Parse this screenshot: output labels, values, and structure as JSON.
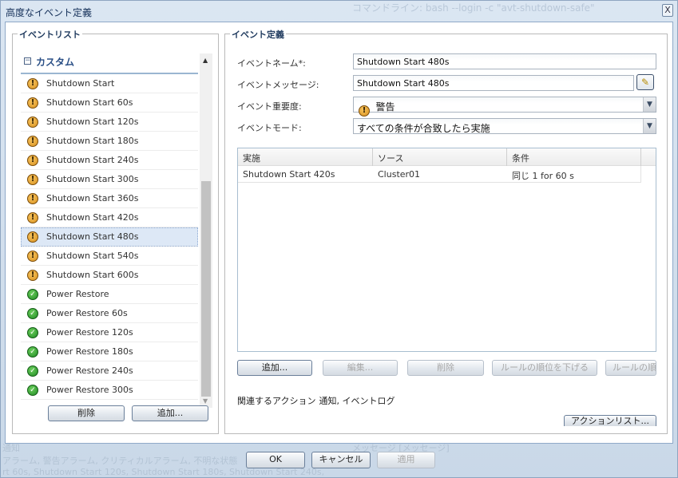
{
  "window": {
    "title": "高度なイベント定義",
    "background_title": "コマンドライン: bash --login -c \"avt-shutdown-safe\"",
    "close_label": "X"
  },
  "event_list": {
    "legend": "イベントリスト",
    "group": {
      "toggle": "⊟",
      "label": "カスタム"
    },
    "items": [
      {
        "label": "Shutdown Start",
        "severity": "warning",
        "selected": false
      },
      {
        "label": "Shutdown Start 60s",
        "severity": "warning",
        "selected": false
      },
      {
        "label": "Shutdown Start 120s",
        "severity": "warning",
        "selected": false
      },
      {
        "label": "Shutdown Start 180s",
        "severity": "warning",
        "selected": false
      },
      {
        "label": "Shutdown Start 240s",
        "severity": "warning",
        "selected": false
      },
      {
        "label": "Shutdown Start 300s",
        "severity": "warning",
        "selected": false
      },
      {
        "label": "Shutdown Start 360s",
        "severity": "warning",
        "selected": false
      },
      {
        "label": "Shutdown Start 420s",
        "severity": "warning",
        "selected": false
      },
      {
        "label": "Shutdown Start 480s",
        "severity": "warning",
        "selected": true
      },
      {
        "label": "Shutdown Start 540s",
        "severity": "warning",
        "selected": false
      },
      {
        "label": "Shutdown Start 600s",
        "severity": "warning",
        "selected": false
      },
      {
        "label": "Power Restore",
        "severity": "ok",
        "selected": false
      },
      {
        "label": "Power Restore 60s",
        "severity": "ok",
        "selected": false
      },
      {
        "label": "Power Restore 120s",
        "severity": "ok",
        "selected": false
      },
      {
        "label": "Power Restore 180s",
        "severity": "ok",
        "selected": false
      },
      {
        "label": "Power Restore 240s",
        "severity": "ok",
        "selected": false
      },
      {
        "label": "Power Restore 300s",
        "severity": "ok",
        "selected": false
      }
    ],
    "delete_label": "削除",
    "add_label": "追加..."
  },
  "event_definition": {
    "legend": "イベント定義",
    "name_label": "イベントネーム*:",
    "name_value": "Shutdown Start 480s",
    "message_label": "イベントメッセージ:",
    "message_value": "Shutdown Start 480s",
    "severity_label": "イベント重要度:",
    "severity_value": "警告",
    "mode_label": "イベントモード:",
    "mode_value": "すべての条件が合致したら実施",
    "table": {
      "columns": [
        "実施",
        "ソース",
        "条件"
      ],
      "rows": [
        [
          "Shutdown Start 420s",
          "Cluster01",
          "同じ 1 for 60 s"
        ]
      ]
    },
    "buttons": {
      "add": "追加...",
      "edit": "編集...",
      "delete": "削除",
      "move_down": "ルールの順位を下げる",
      "move_up": "ルールの順"
    },
    "assoc_label": "関連するアクション",
    "assoc_value": "通知, イベントログ",
    "action_list_label": "アクションリスト..."
  },
  "footer": {
    "ok": "OK",
    "cancel": "キャンセル",
    "apply": "適用"
  },
  "background_text": {
    "line1": "通知",
    "line2": "アラーム, 警告アラーム, クリティカルアラーム, 不明な状態",
    "line3": "rt 60s, Shutdown Start 120s, Shutdown Start 180s, Shutdown Start 240s,",
    "col": "メッセージ [メッセージ]"
  }
}
